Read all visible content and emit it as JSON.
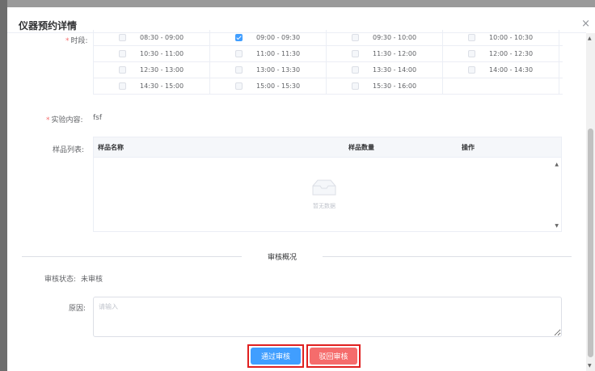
{
  "dialog": {
    "title": "仪器预约详情",
    "close_icon": "×"
  },
  "form": {
    "time_label": "时段:",
    "required_mark": "*",
    "time_slots": [
      {
        "label": "08:30 - 09:00",
        "checked": false
      },
      {
        "label": "09:00 - 09:30",
        "checked": true
      },
      {
        "label": "09:30 - 10:00",
        "checked": false
      },
      {
        "label": "10:00 - 10:30",
        "checked": false
      },
      {
        "label": "10:30 - 11:00",
        "checked": false
      },
      {
        "label": "11:00 - 11:30",
        "checked": false
      },
      {
        "label": "11:30 - 12:00",
        "checked": false
      },
      {
        "label": "12:00 - 12:30",
        "checked": false
      },
      {
        "label": "12:30 - 13:00",
        "checked": false
      },
      {
        "label": "13:00 - 13:30",
        "checked": false
      },
      {
        "label": "13:30 - 14:00",
        "checked": false
      },
      {
        "label": "14:00 - 14:30",
        "checked": false
      },
      {
        "label": "14:30 - 15:00",
        "checked": false
      },
      {
        "label": "15:00 - 15:30",
        "checked": false
      },
      {
        "label": "15:30 - 16:00",
        "checked": false
      }
    ],
    "content_label": "实验内容:",
    "content_value": "fsf",
    "sample_label": "样品列表:",
    "sample_table": {
      "headers": [
        "样品名称",
        "样品数量",
        "操作"
      ],
      "empty_text": "暂无数据"
    }
  },
  "review": {
    "section_title": "审核概况",
    "status_label": "审核状态:",
    "status_value": "未审核",
    "reason_label": "原因:",
    "reason_placeholder": "请输入"
  },
  "actions": {
    "approve_label": "通过审核",
    "reject_label": "驳回审核"
  },
  "colors": {
    "primary": "#409eff",
    "danger": "#f56c6c",
    "highlight_box": "#e02020"
  }
}
